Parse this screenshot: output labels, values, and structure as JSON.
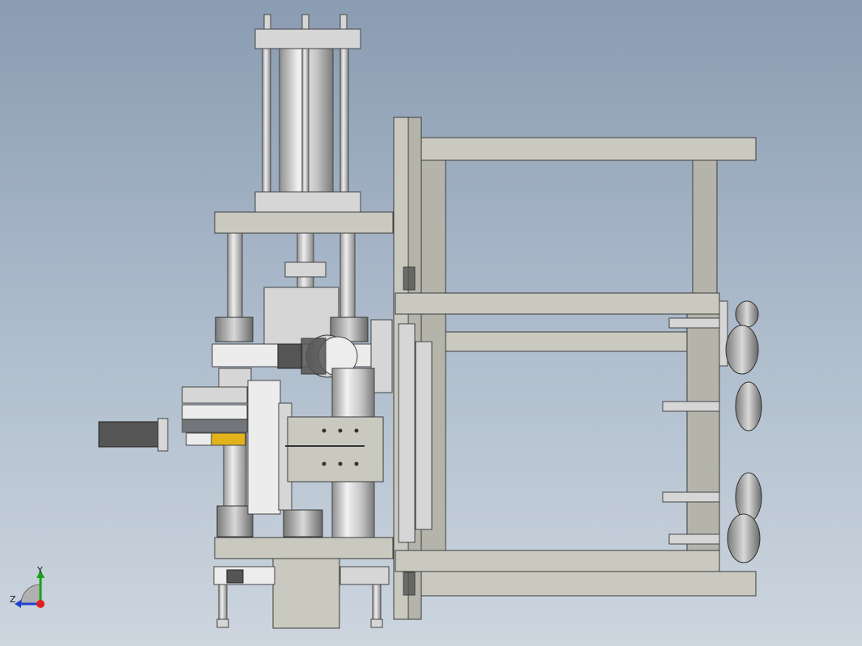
{
  "view": {
    "background_top": "#8a9cb2",
    "background_bottom": "#cdd6df",
    "frame_color": "#c9c9c0",
    "accent_yellow": "#e2b21a"
  },
  "triad": {
    "y_label": "Y",
    "z_label": "Z",
    "y_color": "#1aa01a",
    "z_color": "#2040d0",
    "origin_color": "#e02020"
  }
}
